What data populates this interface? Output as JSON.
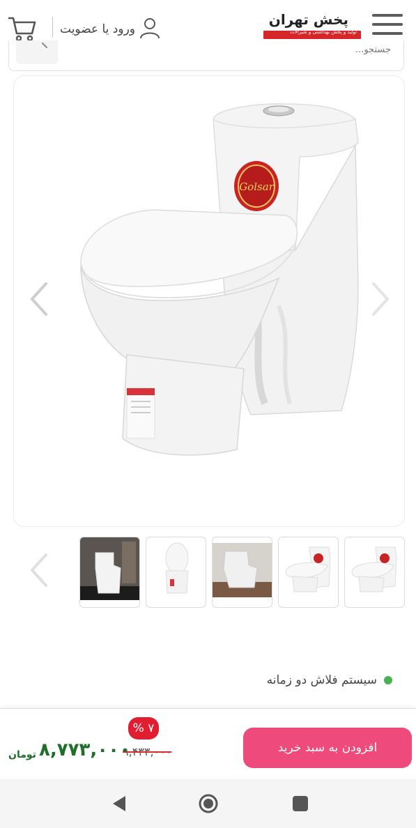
{
  "header": {
    "login_label": "ورود یا عضویت",
    "logo_title": "پخش تهران",
    "logo_subtitle": "تولید و پخش بهداشتی و شیرآلات",
    "brand_color": "#d7262b"
  },
  "search": {
    "placeholder": "جستجو..."
  },
  "gallery": {
    "label_text": "Golsar",
    "thumbnails": [
      {
        "name": "thumb-1"
      },
      {
        "name": "thumb-2"
      },
      {
        "name": "thumb-3"
      },
      {
        "name": "thumb-4"
      },
      {
        "name": "thumb-5"
      }
    ]
  },
  "features": {
    "item_1": "سیستم فلاش دو زمانه"
  },
  "buybar": {
    "add_to_cart_label": "افزودن به سبد خرید",
    "discount_badge": "۷ %",
    "old_price": "۹,۴۳۳,۰۰۰",
    "price": "۸,۷۷۳,۰۰۰",
    "currency": "تومان",
    "button_color": "#ee4a7b",
    "discount_color": "#e11d2f",
    "price_color": "#1f6e2a"
  },
  "navbar": {
    "icons": [
      "back-icon",
      "home-icon",
      "recents-icon"
    ]
  }
}
